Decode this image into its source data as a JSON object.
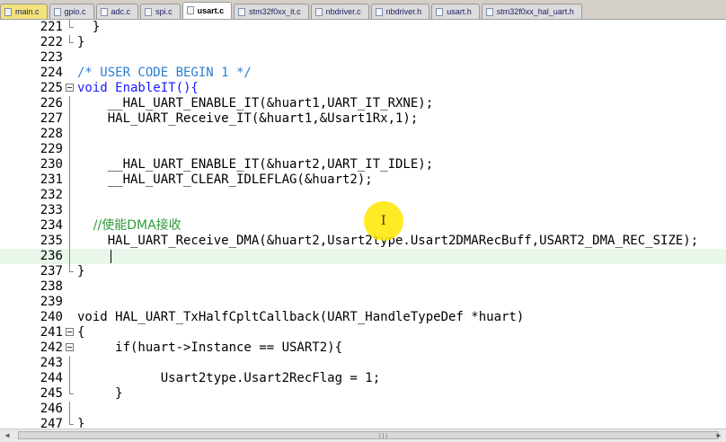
{
  "tabs": [
    {
      "label": "main.c",
      "active": false
    },
    {
      "label": "gpio.c",
      "active": false
    },
    {
      "label": "adc.c",
      "active": false
    },
    {
      "label": "spi.c",
      "active": false
    },
    {
      "label": "usart.c",
      "active": true
    },
    {
      "label": "stm32f0xx_it.c",
      "active": false
    },
    {
      "label": "nbdriver.c",
      "active": false
    },
    {
      "label": "nbdriver.h",
      "active": false
    },
    {
      "label": "usart.h",
      "active": false
    },
    {
      "label": "stm32f0xx_hal_uart.h",
      "active": false
    }
  ],
  "lines": [
    {
      "num": "221",
      "text": "  }"
    },
    {
      "num": "222",
      "text": "}"
    },
    {
      "num": "223",
      "text": ""
    },
    {
      "num": "224",
      "text": "/* USER CODE BEGIN 1 */"
    },
    {
      "num": "225",
      "text": "void EnableIT(){"
    },
    {
      "num": "226",
      "text": "    __HAL_UART_ENABLE_IT(&huart1,UART_IT_RXNE);"
    },
    {
      "num": "227",
      "text": "    HAL_UART_Receive_IT(&huart1,&Usart1Rx,1);"
    },
    {
      "num": "228",
      "text": ""
    },
    {
      "num": "229",
      "text": ""
    },
    {
      "num": "230",
      "text": "    __HAL_UART_ENABLE_IT(&huart2,UART_IT_IDLE);"
    },
    {
      "num": "231",
      "text": "    __HAL_UART_CLEAR_IDLEFLAG(&huart2);"
    },
    {
      "num": "232",
      "text": ""
    },
    {
      "num": "233",
      "text": ""
    },
    {
      "num": "234",
      "text": "    //使能DMA接收"
    },
    {
      "num": "235",
      "text": "    HAL_UART_Receive_DMA(&huart2,Usart2type.Usart2DMARecBuff,USART2_DMA_REC_SIZE);"
    },
    {
      "num": "236",
      "text": ""
    },
    {
      "num": "237",
      "text": "}"
    },
    {
      "num": "238",
      "text": ""
    },
    {
      "num": "239",
      "text": ""
    },
    {
      "num": "240",
      "text": "void HAL_UART_TxHalfCpltCallback(UART_HandleTypeDef *huart)"
    },
    {
      "num": "241",
      "text": "{"
    },
    {
      "num": "242",
      "text": "     if(huart->Instance == USART2){"
    },
    {
      "num": "243",
      "text": ""
    },
    {
      "num": "244",
      "text": "           Usart2type.Usart2RecFlag = 1;"
    },
    {
      "num": "245",
      "text": "     }"
    },
    {
      "num": "246",
      "text": ""
    },
    {
      "num": "247",
      "text": "}"
    }
  ],
  "colors": {
    "comment": "#2b7fd1",
    "keyword": "#1a1aff",
    "highlight": "#e8f7ea"
  }
}
